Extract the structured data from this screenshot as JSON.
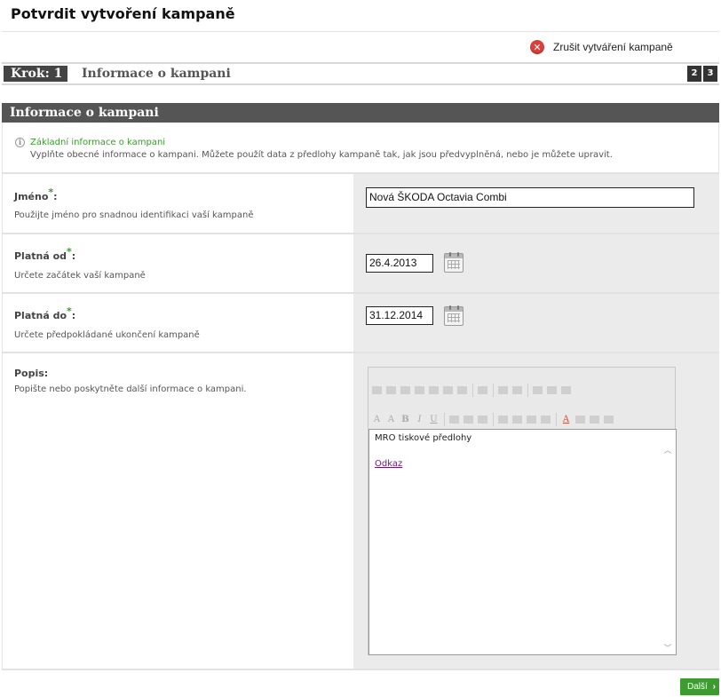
{
  "page": {
    "title": "Potvrdit vytvoření kampaně"
  },
  "cancel": {
    "icon": "close-circle-icon",
    "label": "Zrušit vytváření kampaně",
    "icon_color": "#d9403a"
  },
  "steps": {
    "current_label": "Krok: 1",
    "title": "Informace o kampani",
    "others": [
      "2",
      "3"
    ]
  },
  "section": {
    "title": "Informace o kampani"
  },
  "info": {
    "icon": "info-icon",
    "title": "Základní informace o kampani",
    "text": "Vyplňte obecné informace o kampani. Můžete použít data z předlohy kampaně tak, jak jsou předvyplněná, nebo je můžete upravit."
  },
  "fields": {
    "name": {
      "label": "Jméno",
      "required_mark": "*",
      "suffix": ":",
      "help": "Použijte jméno pro snadnou identifikaci vaší kampaně",
      "value": "Nová ŠKODA Octavia Combi"
    },
    "valid_from": {
      "label": "Platná od",
      "required_mark": "*",
      "suffix": ":",
      "help": "Určete začátek vaší kampaně",
      "value": "26.4.2013",
      "icon": "calendar-icon"
    },
    "valid_to": {
      "label": "Platná do",
      "required_mark": "*",
      "suffix": ":",
      "help": "Určete předpokládané ukončení kampaně",
      "value": "31.12.2014",
      "icon": "calendar-icon"
    },
    "description": {
      "label": "Popis:",
      "help": "Popište nebo poskytněte další informace o kampani.",
      "content_text": "MRO tiskové předlohy",
      "content_link": "Odkaz"
    }
  },
  "editor_toolbar": {
    "row1": [
      "cut-icon",
      "copy-icon",
      "paste-icon",
      "paste-text-icon",
      "undo-icon",
      "redo-icon",
      "table-icon",
      "sep",
      "indent-icon",
      "sep",
      "horizontal-rule-icon",
      "special-char-icon",
      "sep",
      "link-icon",
      "image-icon",
      "source-icon"
    ],
    "row2": [
      "font-size-icon",
      "font-family-icon",
      "bold-icon",
      "italic-icon",
      "underline-icon",
      "sep",
      "align-left-icon",
      "align-center-icon",
      "align-right-icon",
      "sep",
      "ordered-list-icon",
      "unordered-list-icon",
      "outdent-icon",
      "indent-icon",
      "sep",
      "font-color-icon",
      "highlight-icon",
      "clear-format-icon",
      "rtl-icon"
    ]
  },
  "footer": {
    "next_label": "Další",
    "next_arrow": "›",
    "accent": "#3e9b32"
  }
}
